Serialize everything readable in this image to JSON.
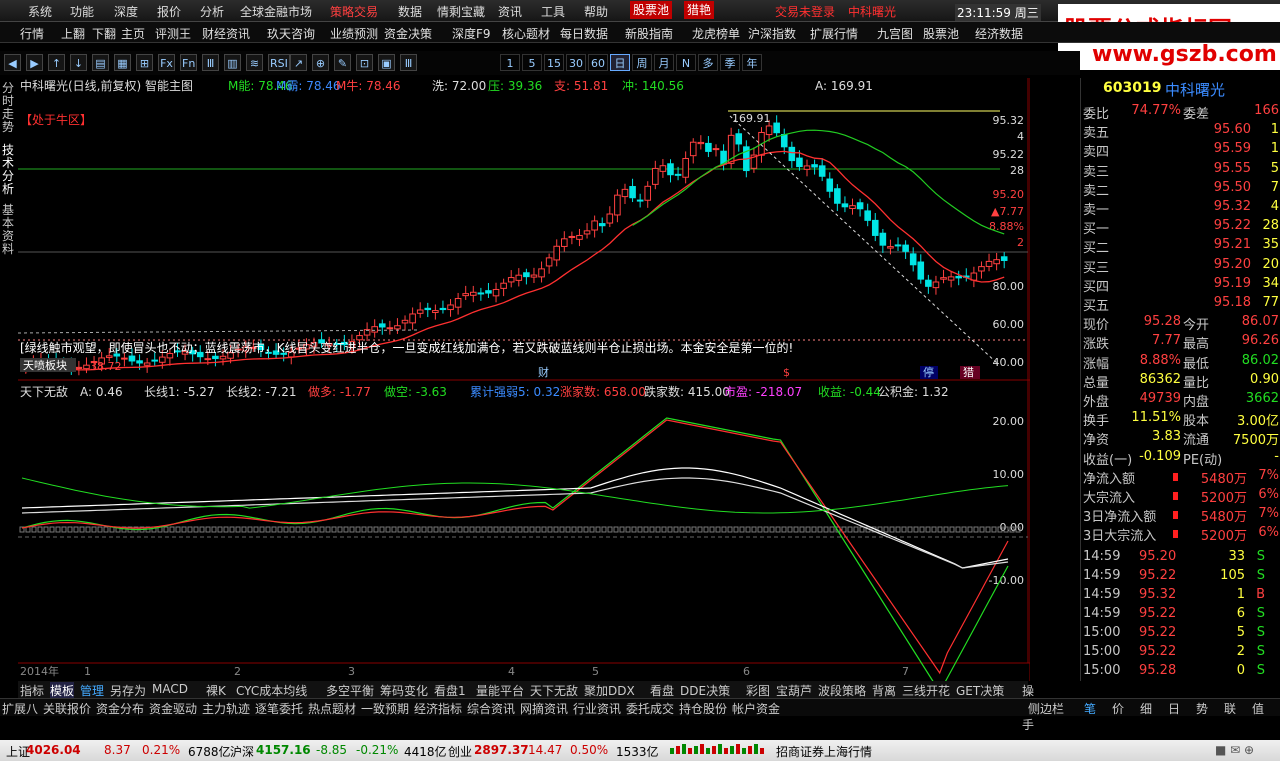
{
  "menu": [
    "系统",
    "功能",
    "深度",
    "报价",
    "分析",
    "全球金融市场",
    "策略交易",
    "数据",
    "情剩宝藏",
    "资讯",
    "工具",
    "帮助",
    "股票池",
    "猎艳",
    "交易未登录",
    "中科曙光"
  ],
  "clock": "23:11:59 周三",
  "toolbar1": [
    "行情",
    "上翻",
    "下翻",
    "主页",
    "评测王",
    "财经资讯",
    "玖天咨询",
    "业绩预测",
    "资金决策",
    "深度F9",
    "核心题材",
    "每日数据",
    "新股指南",
    "龙虎榜单",
    "沪深指数",
    "扩展行情",
    "九宫图",
    "股票池",
    "经济数据"
  ],
  "periods": [
    "1",
    "5",
    "15",
    "30",
    "60",
    "日",
    "周",
    "月",
    "N",
    "多",
    "季",
    "年"
  ],
  "left_tabs": [
    "分时走势",
    "技术分析",
    "基本资料"
  ],
  "main_header": {
    "title": "中科曙光(日线,前复权) 智能主图",
    "items": [
      "M能: 78.46",
      "M霸: 78.46",
      "M牛: 78.46",
      "洗: 72.00",
      "压: 39.36",
      "支: 51.81",
      "冲: 140.56"
    ],
    "a_value": "A: 169.91"
  },
  "tags": {
    "bull": "【处于牛区】",
    "peak": "169.91",
    "banner": "[绿线触市观望，即使冒头也不动；蓝线震荡市，K线冒头变红进半仓，一旦变成红线加满仓，若又跌破蓝线则半仓止损出场。本金安全是第一位的!",
    "tianbao": "天喷板块",
    "low_val": "38.72",
    "cai": "财",
    "dollar": "$",
    "ting": "停",
    "yan": "猎"
  },
  "price_axis": [
    "95.32",
    "4",
    "95.22",
    "28",
    "95.20",
    "▲7.77",
    "8.88%",
    "2",
    "80.00",
    "60.00",
    "40.00"
  ],
  "sub_header": {
    "title": "天下无敌",
    "items": [
      "A: 0.46",
      "长线1: -5.27",
      "长线2: -7.21",
      "做多: -1.77",
      "做空: -3.63",
      "累计强弱5: 0.32",
      "涨家数: 658.00",
      "跌家数: 415.00",
      "市盈: -218.07",
      "收益: -0.44",
      "公积金: 1.32"
    ]
  },
  "sub_axis": [
    "20.00",
    "10.00",
    "0.00",
    "-10.00"
  ],
  "x_axis": [
    "2014年",
    "1",
    "2",
    "3",
    "4",
    "5",
    "6",
    "7"
  ],
  "quote": {
    "code": "603019",
    "name": "中科曙光",
    "weibi": {
      "label": "委比",
      "value": "74.77%",
      "label2": "委差",
      "value2": "166"
    },
    "asks": [
      [
        "卖五",
        "95.60",
        "1"
      ],
      [
        "卖四",
        "95.59",
        "1"
      ],
      [
        "卖三",
        "95.55",
        "5"
      ],
      [
        "卖二",
        "95.50",
        "7"
      ],
      [
        "卖一",
        "95.32",
        "4"
      ]
    ],
    "bids": [
      [
        "买一",
        "95.22",
        "28"
      ],
      [
        "买二",
        "95.21",
        "35"
      ],
      [
        "买三",
        "95.20",
        "20"
      ],
      [
        "买四",
        "95.19",
        "34"
      ],
      [
        "买五",
        "95.18",
        "77"
      ]
    ],
    "stats": [
      [
        "现价",
        "95.28",
        "今开",
        "86.07"
      ],
      [
        "涨跌",
        "7.77",
        "最高",
        "96.26"
      ],
      [
        "涨幅",
        "8.88%",
        "最低",
        "86.02"
      ],
      [
        "总量",
        "86362",
        "量比",
        "0.90"
      ],
      [
        "外盘",
        "49739",
        "内盘",
        "3662"
      ],
      [
        "换手",
        "11.51%",
        "股本",
        "3.00亿"
      ],
      [
        "净资",
        "3.83",
        "流通",
        "7500万"
      ],
      [
        "收益(一)",
        "-0.109",
        "PE(动)",
        "-"
      ]
    ],
    "flows": [
      [
        "净流入额",
        "5480万",
        "7%"
      ],
      [
        "大宗流入",
        "5200万",
        "6%"
      ],
      [
        "3日净流入额",
        "5480万",
        "7%"
      ],
      [
        "3日大宗流入",
        "5200万",
        "6%"
      ]
    ],
    "ticks": [
      [
        "14:59",
        "95.20",
        "33",
        "S"
      ],
      [
        "14:59",
        "95.22",
        "105",
        "S"
      ],
      [
        "14:59",
        "95.32",
        "1",
        "B"
      ],
      [
        "14:59",
        "95.22",
        "6",
        "S"
      ],
      [
        "15:00",
        "95.22",
        "5",
        "S"
      ],
      [
        "15:00",
        "95.22",
        "2",
        "S"
      ],
      [
        "15:00",
        "95.28",
        "0",
        "S"
      ]
    ]
  },
  "bottom_tabs": [
    "指标",
    "模板",
    "管理",
    "另存为",
    "MACD",
    "裸K",
    "CYC成本均线",
    "多空平衡",
    "筹码变化",
    "看盘1",
    "量能平台",
    "天下无敌",
    "聚加DDX",
    "看盘",
    "DDE决策",
    "彩图",
    "宝葫芦",
    "波段策略",
    "背离",
    "三线开花",
    "GET决策",
    "操盘手"
  ],
  "bottom_tabs2": [
    "扩展八",
    "关联报价",
    "资金分布",
    "资金驱动",
    "主力轨迹",
    "逐笔委托",
    "热点题材",
    "一致预期",
    "经济指标",
    "综合资讯",
    "网摘资讯",
    "行业资讯",
    "委托成交",
    "持仓股份",
    "帐户资金"
  ],
  "right_bottom_tabs": [
    "笔",
    "价",
    "细",
    "日",
    "势",
    "联",
    "值"
  ],
  "side_label": "侧边栏",
  "status": {
    "sh_label": "上证",
    "sh_val": "4026.04",
    "sh_chg": "8.37",
    "sh_pct": "0.21%",
    "sh_amt": "6788亿",
    "hs_label": "沪深",
    "hs_val": "4157.16",
    "hs_chg": "-8.85",
    "hs_pct": "-0.21%",
    "hs_amt": "4418亿",
    "cy_label": "创业",
    "cy_val": "2897.37",
    "cy_chg": "14.47",
    "cy_pct": "0.50%",
    "cy_amt": "1533亿",
    "broker": "招商证券上海行情"
  },
  "logo": {
    "line1": "股票公式指标网",
    "line2": "www.gszb.com"
  },
  "colors": {
    "up": "#ff3232",
    "down": "#00e5e5",
    "green": "#22dd22",
    "yellow": "#ffff00",
    "panel": "#000000"
  },
  "chart_data": {
    "type": "candlestick",
    "x": [
      "2014-12",
      "2015-01",
      "2015-02",
      "2015-03",
      "2015-04",
      "2015-05",
      "2015-06",
      "2015-07"
    ],
    "ohlc_trend": [
      38.72,
      45,
      52,
      60,
      80,
      120,
      169.91,
      95.28
    ],
    "sub_series": [
      "长线1",
      "长线2",
      "做多",
      "做空"
    ]
  }
}
